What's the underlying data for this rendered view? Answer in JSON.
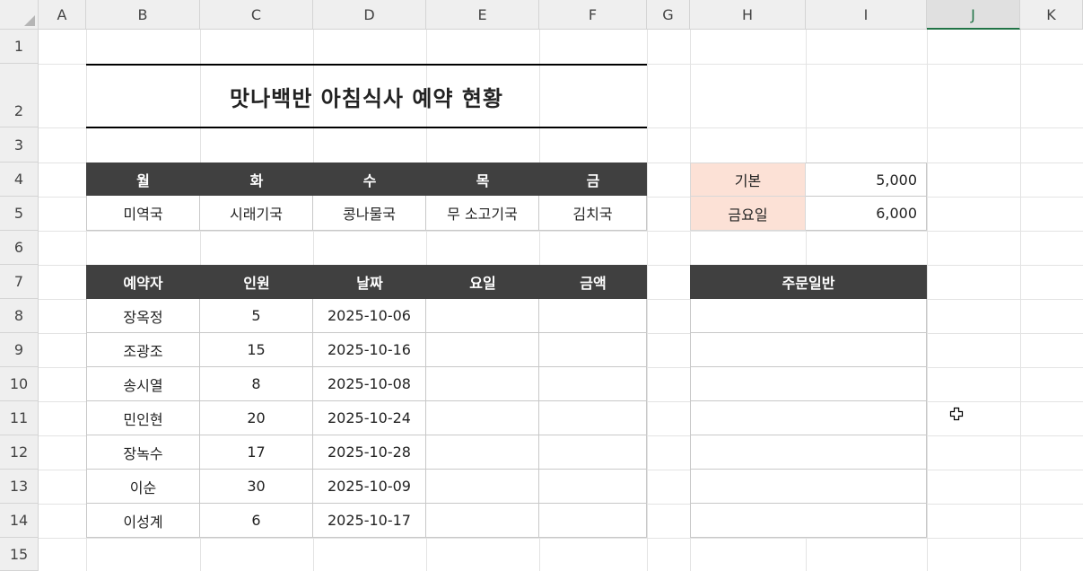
{
  "columns": [
    "A",
    "B",
    "C",
    "D",
    "E",
    "F",
    "G",
    "H",
    "I",
    "J",
    "K"
  ],
  "rows": [
    "1",
    "2",
    "3",
    "4",
    "5",
    "6",
    "7",
    "8",
    "9",
    "10",
    "11",
    "12",
    "13",
    "14",
    "15"
  ],
  "selected_column": "J",
  "title": "맛나백반 아침식사 예약 현황",
  "menu": {
    "days": [
      "월",
      "화",
      "수",
      "목",
      "금"
    ],
    "dishes": [
      "미역국",
      "시래기국",
      "콩나물국",
      "무 소고기국",
      "김치국"
    ]
  },
  "prices": {
    "basic_label": "기본",
    "basic_value": "5,000",
    "friday_label": "금요일",
    "friday_value": "6,000"
  },
  "reservations": {
    "headers": [
      "예약자",
      "인원",
      "날짜",
      "요일",
      "금액"
    ],
    "rows": [
      [
        "장옥정",
        "5",
        "2025-10-06",
        "",
        ""
      ],
      [
        "조광조",
        "15",
        "2025-10-16",
        "",
        ""
      ],
      [
        "송시열",
        "8",
        "2025-10-08",
        "",
        ""
      ],
      [
        "민인현",
        "20",
        "2025-10-24",
        "",
        ""
      ],
      [
        "장녹수",
        "17",
        "2025-10-28",
        "",
        ""
      ],
      [
        "이순",
        "30",
        "2025-10-09",
        "",
        ""
      ],
      [
        "이성계",
        "6",
        "2025-10-17",
        "",
        ""
      ]
    ]
  },
  "general_orders": {
    "header": "주문일반",
    "values": [
      "",
      "",
      "",
      "",
      "",
      "",
      ""
    ]
  },
  "colors": {
    "header_bg": "#404040",
    "header_text": "#ffffff",
    "price_label_bg": "#fce1d6",
    "selected_column_accent": "#217346"
  },
  "cursor_icon": "excel-cross-cursor-icon"
}
